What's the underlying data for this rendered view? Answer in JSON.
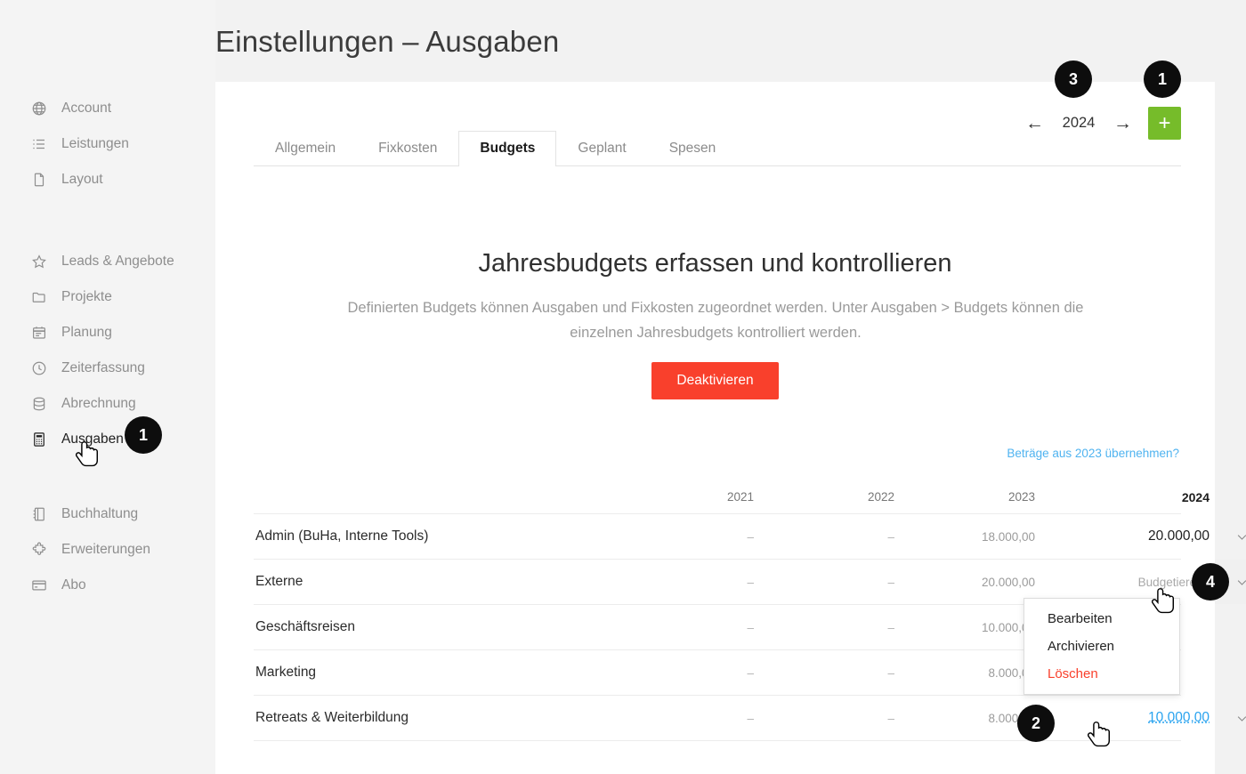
{
  "page": {
    "title": "Einstellungen – Ausgaben"
  },
  "sidebar": {
    "groups": [
      {
        "items": [
          {
            "label": "Account",
            "icon": "globe-icon",
            "active": false
          },
          {
            "label": "Leistungen",
            "icon": "list-icon",
            "active": false
          },
          {
            "label": "Layout",
            "icon": "document-icon",
            "active": false
          }
        ]
      },
      {
        "items": [
          {
            "label": "Leads & Angebote",
            "icon": "star-icon",
            "active": false
          },
          {
            "label": "Projekte",
            "icon": "folder-icon",
            "active": false
          },
          {
            "label": "Planung",
            "icon": "calendar-icon",
            "active": false
          },
          {
            "label": "Zeiterfassung",
            "icon": "clock-icon",
            "active": false
          },
          {
            "label": "Abrechnung",
            "icon": "database-icon",
            "active": false
          },
          {
            "label": "Ausgaben",
            "icon": "calculator-icon",
            "active": true
          }
        ]
      },
      {
        "items": [
          {
            "label": "Buchhaltung",
            "icon": "notebook-icon",
            "active": false
          },
          {
            "label": "Erweiterungen",
            "icon": "puzzle-icon",
            "active": false
          },
          {
            "label": "Abo",
            "icon": "credit-card-icon",
            "active": false
          }
        ]
      }
    ]
  },
  "toolbar": {
    "prev_arrow": "←",
    "year": "2024",
    "next_arrow": "→",
    "add_label": "+"
  },
  "tabs": [
    {
      "label": "Allgemein",
      "active": false
    },
    {
      "label": "Fixkosten",
      "active": false
    },
    {
      "label": "Budgets",
      "active": true
    },
    {
      "label": "Geplant",
      "active": false
    },
    {
      "label": "Spesen",
      "active": false
    }
  ],
  "content": {
    "headline": "Jahresbudgets erfassen und kontrollieren",
    "description": "Definierten Budgets können Ausgaben und Fixkosten zugeordnet werden. Unter Ausgaben > Budgets können die einzelnen Jahresbudgets kontrolliert werden.",
    "deactivate_label": "Deaktivieren",
    "takeover_link": "Beträge aus 2023 übernehmen?"
  },
  "table": {
    "columns": [
      "",
      "2021",
      "2022",
      "2023",
      "2024"
    ],
    "rows": [
      {
        "name": "Admin (BuHa, Interne Tools)",
        "y2021": "–",
        "y2022": "–",
        "y2023": "18.000,00",
        "y2024": "20.000,00",
        "y2024_state": "value"
      },
      {
        "name": "Externe",
        "y2021": "–",
        "y2022": "–",
        "y2023": "20.000,00",
        "y2024": "Budgetieren?",
        "y2024_state": "placeholder"
      },
      {
        "name": "Geschäftsreisen",
        "y2021": "–",
        "y2022": "–",
        "y2023": "10.000,00",
        "y2024": "",
        "y2024_state": "empty"
      },
      {
        "name": "Marketing",
        "y2021": "–",
        "y2022": "–",
        "y2023": "8.000,00",
        "y2024": "",
        "y2024_state": "empty"
      },
      {
        "name": "Retreats & Weiterbildung",
        "y2021": "–",
        "y2022": "–",
        "y2023": "8.000,00",
        "y2024": "10.000,00",
        "y2024_state": "link"
      }
    ]
  },
  "dropdown": {
    "items": [
      {
        "label": "Bearbeiten",
        "danger": false
      },
      {
        "label": "Archivieren",
        "danger": false
      },
      {
        "label": "Löschen",
        "danger": true
      }
    ]
  },
  "markers": [
    {
      "id": "sidebar-ausgaben",
      "number": "1"
    },
    {
      "id": "add-budget",
      "number": "1"
    },
    {
      "id": "year-nav",
      "number": "3"
    },
    {
      "id": "amount-edit",
      "number": "2"
    },
    {
      "id": "row-menu",
      "number": "4"
    }
  ],
  "colors": {
    "accent_green": "#76bc2a",
    "danger_red": "#f9402c",
    "link_blue": "#4fb3f0",
    "amount_link_blue": "#29a3ef",
    "badge_black": "#0d0d0d",
    "page_bg": "#f2f2f2",
    "sidebar_bg": "#f4f4f4"
  }
}
